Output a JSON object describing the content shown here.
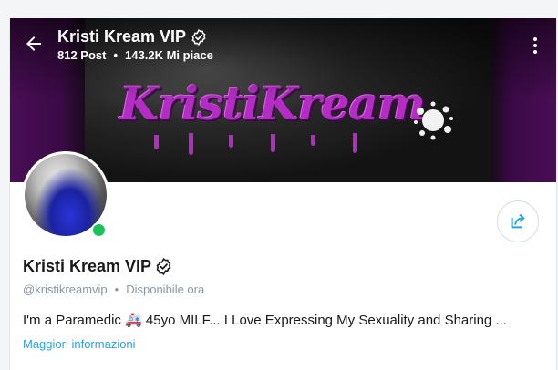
{
  "profile": {
    "display_name": "Kristi Kream VIP",
    "posts": "812 Post",
    "likes": "143.2K Mi piace",
    "handle": "@kristikreamvip",
    "status": "Disponibile ora",
    "bio": "I'm a Paramedic 🚑 45yo MILF... I Love Expressing My Sexuality and Sharing ...",
    "more_info_label": "Maggiori informazioni"
  },
  "banner": {
    "logo_text": "KristiKream"
  },
  "icons": {
    "back": "arrow-left-icon",
    "verified": "verified-badge-icon",
    "more": "more-vertical-icon",
    "share": "share-icon",
    "online": "online-status-icon"
  },
  "colors": {
    "accent": "#2aa2e0",
    "banner_purple": "#b32cc4",
    "online_green": "#18c35a",
    "muted_text": "#8a96a3"
  }
}
